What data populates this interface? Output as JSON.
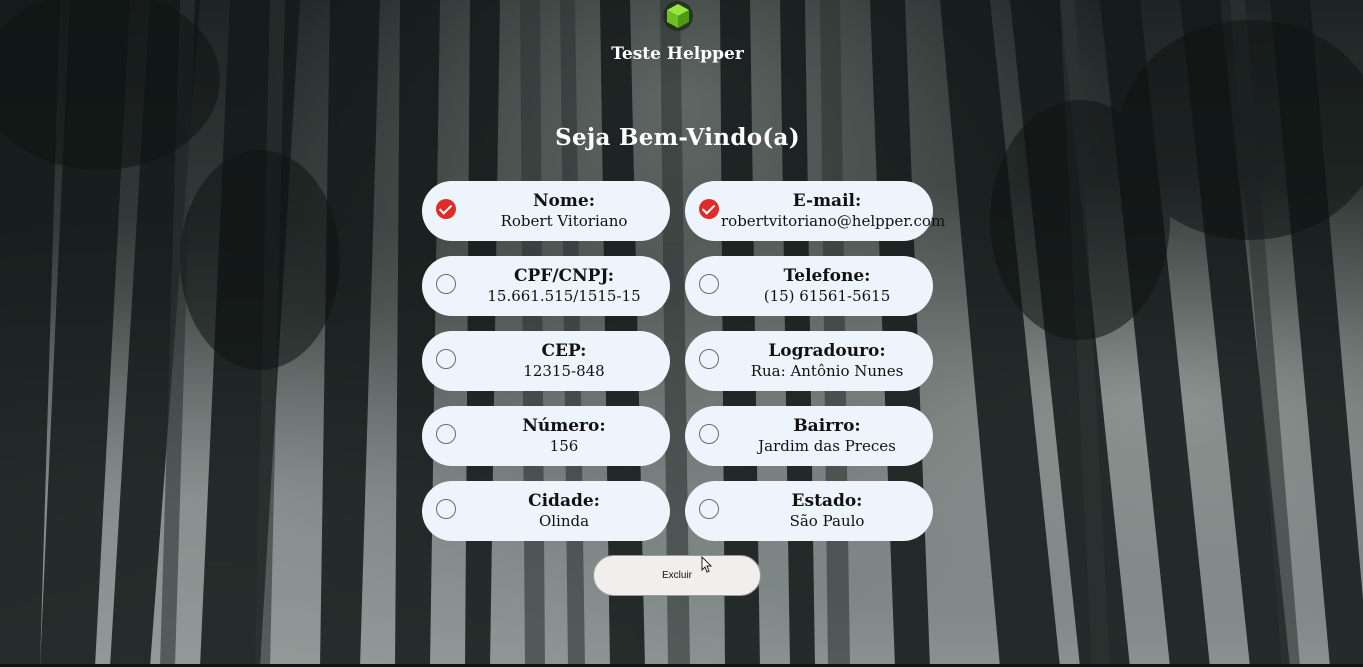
{
  "header": {
    "brand_name": "Teste Helpper",
    "logo_icon": "green-cube-icon",
    "welcome": "Seja Bem-Vindo(a)"
  },
  "fields": [
    {
      "label": "Nome:",
      "value": "Robert Vitoriano",
      "checked": true
    },
    {
      "label": "E-mail:",
      "value": "robertvitoriano@helpper.com",
      "checked": true
    },
    {
      "label": "CPF/CNPJ:",
      "value": "15.661.515/1515-15",
      "checked": false
    },
    {
      "label": "Telefone:",
      "value": "(15) 61561-5615",
      "checked": false
    },
    {
      "label": "CEP:",
      "value": "12315-848",
      "checked": false
    },
    {
      "label": "Logradouro:",
      "value": "Rua: Antônio Nunes",
      "checked": false
    },
    {
      "label": "Número:",
      "value": "156",
      "checked": false
    },
    {
      "label": "Bairro:",
      "value": "Jardim das Preces",
      "checked": false
    },
    {
      "label": "Cidade:",
      "value": "Olinda",
      "checked": false
    },
    {
      "label": "Estado:",
      "value": "São Paulo",
      "checked": false
    }
  ],
  "actions": {
    "delete_label": "Excluir"
  },
  "colors": {
    "card_bg": "#eef4fb",
    "check_red": "#e02b2b",
    "logo_green": "#7ed321"
  }
}
